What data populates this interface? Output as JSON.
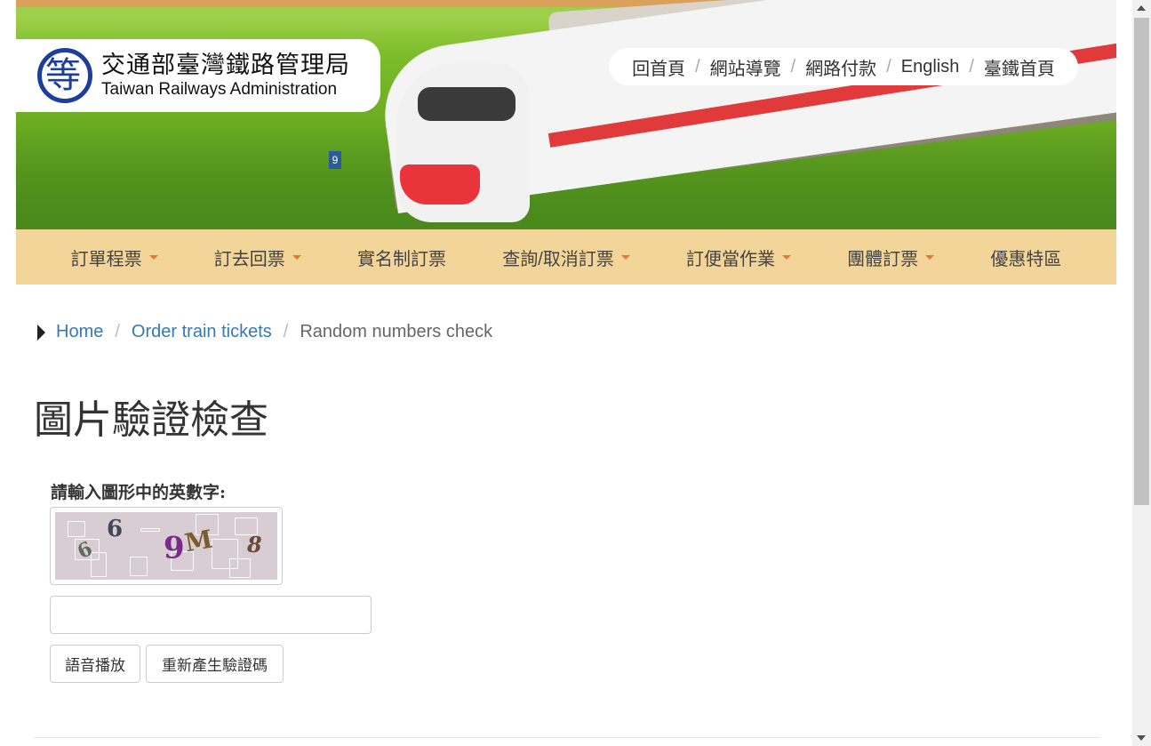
{
  "header": {
    "logo_cn": "交通部臺灣鐵路管理局",
    "logo_en": "Taiwan Railways Administration",
    "sign_number": "9",
    "top_links": [
      "回首頁",
      "網站導覽",
      "網路付款",
      "English",
      "臺鐵首頁"
    ],
    "link_separator": "/"
  },
  "nav": {
    "items": [
      {
        "label": "訂單程票",
        "dropdown": true
      },
      {
        "label": "訂去回票",
        "dropdown": true
      },
      {
        "label": "實名制訂票",
        "dropdown": false
      },
      {
        "label": "查詢/取消訂票",
        "dropdown": true
      },
      {
        "label": "訂便當作業",
        "dropdown": true
      },
      {
        "label": "團體訂票",
        "dropdown": true
      },
      {
        "label": "優惠特區",
        "dropdown": false
      }
    ]
  },
  "breadcrumb": {
    "home": "Home",
    "parent": "Order train tickets",
    "current": "Random numbers check",
    "separator": "/"
  },
  "page": {
    "title": "圖片驗證檢查",
    "captcha_label": "請輸入圖形中的英數字:",
    "captcha_glyphs": [
      "6",
      "6",
      "M",
      "8"
    ],
    "input_value": "",
    "audio_button": "語音播放",
    "regen_button": "重新產生驗證碼"
  },
  "colors": {
    "nav_bg": "#f3d499",
    "caret": "#e07a2f",
    "link": "#337ab7",
    "logo_blue": "#1d3f9a"
  }
}
